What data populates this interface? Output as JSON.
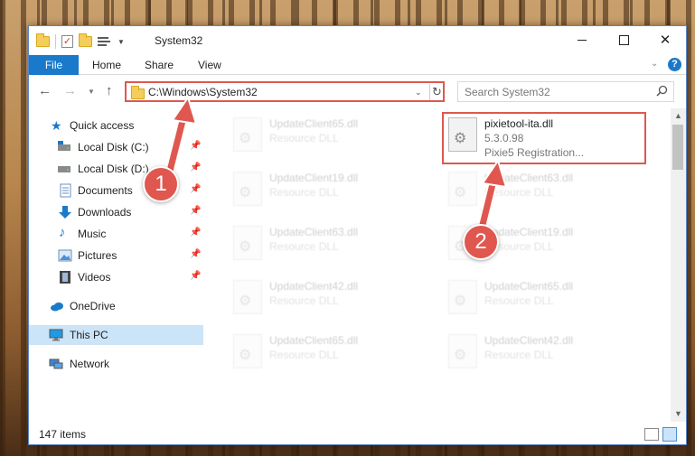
{
  "window": {
    "title": "System32",
    "controls": {
      "minimize": "",
      "maximize": "",
      "close": "✕"
    }
  },
  "ribbon": {
    "tabs": [
      "File",
      "Home",
      "Share",
      "View"
    ],
    "help": "?"
  },
  "address": {
    "path": "C:\\Windows\\System32",
    "search_placeholder": "Search System32"
  },
  "sidebar": {
    "items": [
      {
        "label": "Quick access",
        "icon": "star-icon",
        "pinned": false
      },
      {
        "label": "Local Disk (C:)",
        "icon": "drive-icon",
        "pinned": true
      },
      {
        "label": "Local Disk (D:)",
        "icon": "drive-icon",
        "pinned": true
      },
      {
        "label": "Documents",
        "icon": "documents-icon",
        "pinned": true
      },
      {
        "label": "Downloads",
        "icon": "download-icon",
        "pinned": true
      },
      {
        "label": "Music",
        "icon": "music-icon",
        "pinned": true
      },
      {
        "label": "Pictures",
        "icon": "pictures-icon",
        "pinned": true
      },
      {
        "label": "Videos",
        "icon": "videos-icon",
        "pinned": true
      },
      {
        "label": "OneDrive",
        "icon": "cloud-icon",
        "pinned": false
      },
      {
        "label": "This PC",
        "icon": "computer-icon",
        "pinned": false,
        "selected": true
      },
      {
        "label": "Network",
        "icon": "network-icon",
        "pinned": false
      }
    ]
  },
  "files": {
    "highlighted": {
      "name": "pixietool-ita.dll",
      "version": "5.3.0.98",
      "description": "Pixie5 Registration..."
    },
    "left_column": [
      {
        "name": "UpdateClient65.dll",
        "desc": "Resource DLL"
      },
      {
        "name": "UpdateClient19.dll",
        "desc": "Resource DLL"
      },
      {
        "name": "UpdateClient63.dll",
        "desc": "Resource DLL"
      },
      {
        "name": "UpdateClient42.dll",
        "desc": "Resource DLL"
      },
      {
        "name": "UpdateClient65.dll",
        "desc": "Resource DLL"
      }
    ],
    "right_column": [
      {
        "name": "UpdateClient63.dll",
        "desc": "Resource DLL"
      },
      {
        "name": "UpdateClient19.dll",
        "desc": "Resource DLL"
      },
      {
        "name": "UpdateClient65.dll",
        "desc": "Resource DLL"
      },
      {
        "name": "UpdateClient42.dll",
        "desc": "Resource DLL"
      }
    ]
  },
  "status": {
    "items_count": "147 items"
  },
  "callouts": [
    "1",
    "2"
  ],
  "colors": {
    "accent": "#1979ca",
    "highlight": "#e0574f",
    "selected_bg": "#cce4f7"
  }
}
